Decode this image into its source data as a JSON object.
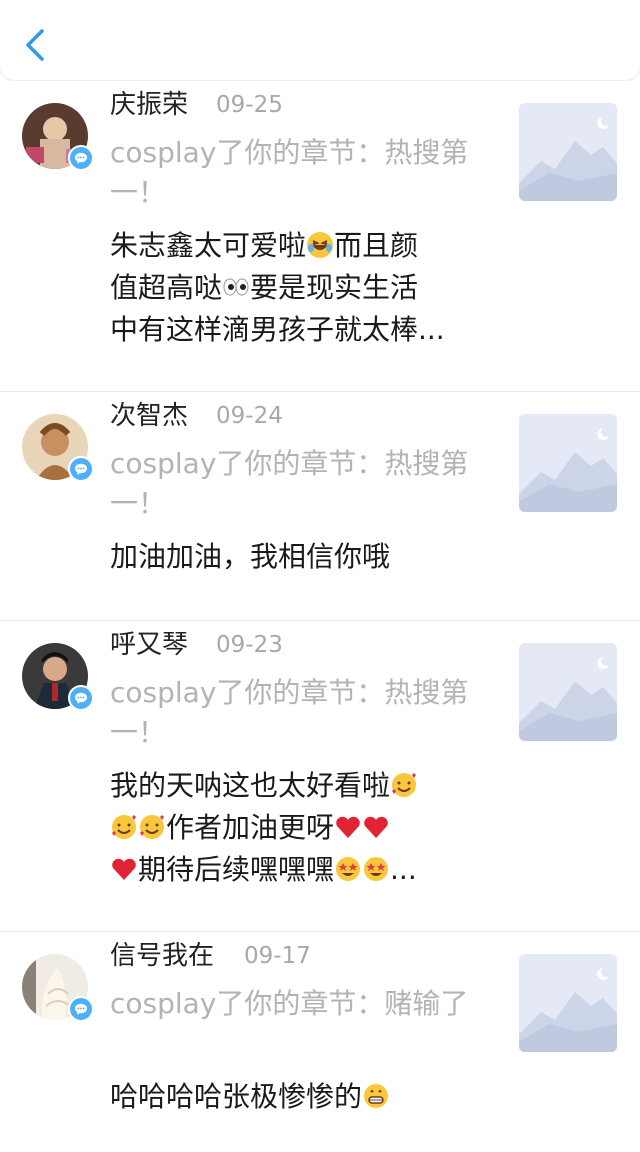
{
  "header": {
    "back_icon": "chevron-left-icon",
    "accent": "#2f9ae8"
  },
  "items": [
    {
      "username": "庆振荣",
      "date": "09-25",
      "action": "cosplay了你的章节：热搜第一！",
      "comment_lines": [
        "朱志鑫太可爱啦",
        "😂",
        "而且颜",
        "值超高哒",
        "👀",
        "要是现实生活",
        "中有这样滴男孩子就太棒..."
      ]
    },
    {
      "username": "次智杰",
      "date": "09-24",
      "action": "cosplay了你的章节：热搜第一！",
      "comment": "加油加油，我相信你哦"
    },
    {
      "username": "呼又琴",
      "date": "09-23",
      "action": "cosplay了你的章节：热搜第一！",
      "comment_lines": [
        "我的天呐这也太好看啦",
        "作者加油更呀",
        "期待后续嘿嘿嘿",
        "..."
      ]
    },
    {
      "username": "信号我在",
      "date": "09-17",
      "action": "cosplay了你的章节：赌输了",
      "comment": "哈哈哈哈张极惨惨的"
    }
  ]
}
